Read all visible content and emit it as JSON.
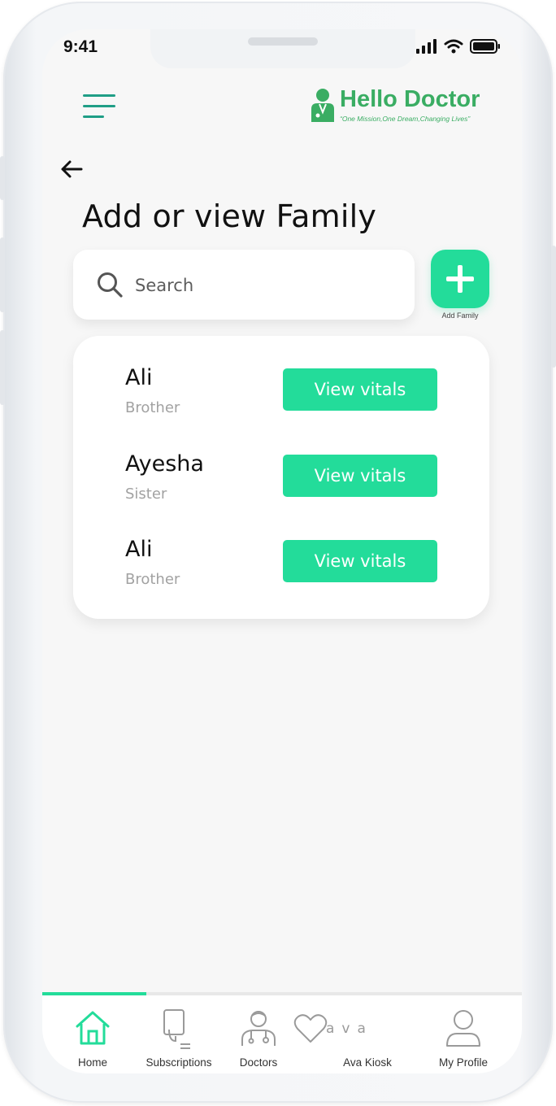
{
  "status_bar": {
    "time": "9:41"
  },
  "header": {
    "logo_title": "Hello Doctor",
    "logo_tagline": "“One Mission,One Dream,Changing Lives”"
  },
  "page": {
    "title": "Add or view Family"
  },
  "search": {
    "placeholder": "Search",
    "value": ""
  },
  "add_family": {
    "label": "Add Family"
  },
  "family": [
    {
      "name": "Ali",
      "relation": "Brother",
      "action": "View vitals"
    },
    {
      "name": "Ayesha",
      "relation": "Sister",
      "action": "View vitals"
    },
    {
      "name": "Ali",
      "relation": "Brother",
      "action": "View vitals"
    }
  ],
  "tabs": [
    {
      "label": "Home",
      "icon": "home-icon",
      "active": true
    },
    {
      "label": "Subscriptions",
      "icon": "subscriptions-icon",
      "active": false
    },
    {
      "label": "Doctors",
      "icon": "doctor-icon",
      "active": false
    },
    {
      "label": "Ava Kiosk",
      "icon": "heart-icon",
      "icon_text": "ava",
      "active": false
    },
    {
      "label": "My Profile",
      "icon": "user-icon",
      "active": false
    }
  ],
  "colors": {
    "accent": "#23dc9a",
    "brand": "#3aad63",
    "menu": "#1f9e86",
    "background": "#f7f7f7"
  }
}
